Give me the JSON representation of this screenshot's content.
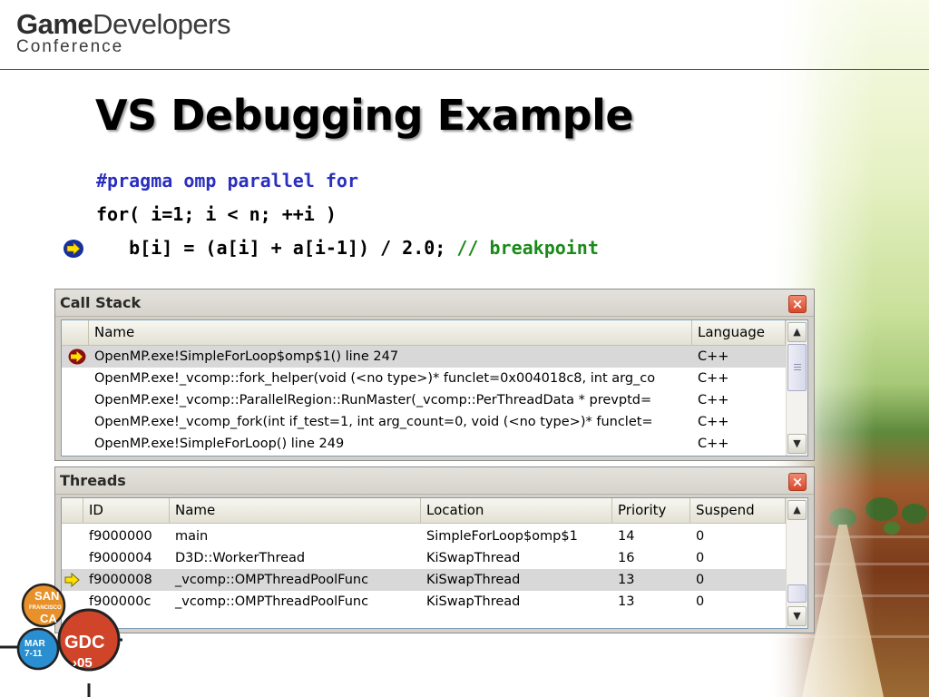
{
  "logo": {
    "brand_bold": "Game",
    "brand_light": "Developers",
    "subline": "Conference"
  },
  "slide": {
    "title": "VS Debugging Example",
    "code": {
      "line1": "#pragma omp parallel for",
      "line2": "for( i=1; i < n; ++i )",
      "line3_code": "   b[i] = (a[i] + a[i-1]) / 2.0; ",
      "line3_comment": "// breakpoint"
    }
  },
  "call_stack": {
    "title": "Call Stack",
    "close": "×",
    "columns": [
      "Name",
      "Language"
    ],
    "rows": [
      {
        "name": "OpenMP.exe!SimpleForLoop$omp$1()  line 247",
        "language": "C++",
        "current": true
      },
      {
        "name": "OpenMP.exe!_vcomp::fork_helper(void (<no type>)* funclet=0x004018c8, int arg_co",
        "language": "C++"
      },
      {
        "name": "OpenMP.exe!_vcomp::ParallelRegion::RunMaster(_vcomp::PerThreadData * prevptd=",
        "language": "C++"
      },
      {
        "name": "OpenMP.exe!_vcomp_fork(int if_test=1, int arg_count=0, void (<no type>)* funclet=",
        "language": "C++"
      },
      {
        "name": "OpenMP.exe!SimpleForLoop()  line 249",
        "language": "C++"
      }
    ]
  },
  "threads": {
    "title": "Threads",
    "close": "×",
    "columns": [
      "ID",
      "Name",
      "Location",
      "Priority",
      "Suspend"
    ],
    "rows": [
      {
        "id": "f9000000",
        "name": "main",
        "location": "SimpleForLoop$omp$1",
        "priority": "14",
        "suspend": "0"
      },
      {
        "id": "f9000004",
        "name": "D3D::WorkerThread",
        "location": "KiSwapThread",
        "priority": "16",
        "suspend": "0"
      },
      {
        "id": "f9000008",
        "name": "_vcomp::OMPThreadPoolFunc",
        "location": "KiSwapThread",
        "priority": "13",
        "suspend": "0",
        "current": true
      },
      {
        "id": "f900000c",
        "name": "_vcomp::OMPThreadPoolFunc",
        "location": "KiSwapThread",
        "priority": "13",
        "suspend": "0"
      }
    ]
  },
  "badge": {
    "city_1": "SAN",
    "city_2": "FRANCISCO",
    "city_3": "CA",
    "date_1": "MAR",
    "date_2": "7-11",
    "event": "GDC",
    "year": "›05"
  },
  "colors": {
    "pragma_blue": "#2a2fbf",
    "comment_green": "#1a8a1a",
    "selected_row": "#d8d8d8",
    "close_red": "#d8482c",
    "badge_orange": "#e8912a",
    "badge_red": "#d0452a",
    "badge_blue": "#2a8fd0"
  },
  "icons": {
    "breakpoint": "current-statement-arrow-icon",
    "close": "close-icon",
    "scroll_up": "scroll-up-arrow-icon",
    "scroll_down": "scroll-down-arrow-icon",
    "thread_marker": "current-thread-arrow-icon"
  }
}
